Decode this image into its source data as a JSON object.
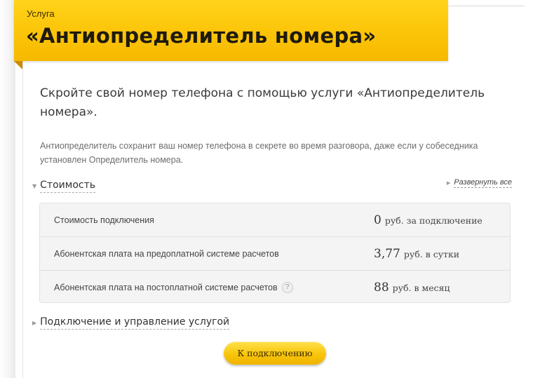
{
  "banner": {
    "kicker": "Услуга",
    "title": "«Антиопределитель номера»"
  },
  "lead": "Скройте свой номер телефона с помощью услуги «Антиопределитель номера».",
  "description": "Антиопределитель сохранит ваш номер телефона в секрете во время разговора, даже если у собеседника установлен Определитель номера.",
  "cost_section": {
    "title": "Стоимость",
    "expand_all": "Развернуть все",
    "rows": [
      {
        "name": "Стоимость подключения",
        "amount": "0",
        "unit": "руб. за подключение",
        "help": false
      },
      {
        "name": "Абонентская плата на предоплатной системе расчетов",
        "amount": "3,77",
        "unit": "руб. в сутки",
        "help": false
      },
      {
        "name": "Абонентская плата на постоплатной системе расчетов",
        "amount": "88",
        "unit": "руб. в месяц",
        "help": true
      }
    ]
  },
  "connect_section": {
    "title": "Подключение и управление услугой"
  },
  "cta": {
    "label": "К подключению"
  },
  "colors": {
    "accent": "#fbc408",
    "accent_dark": "#c98a00"
  },
  "icons": {
    "help": "question-circle-icon",
    "expand": "triangle-down-icon",
    "collapsed": "triangle-right-icon"
  }
}
